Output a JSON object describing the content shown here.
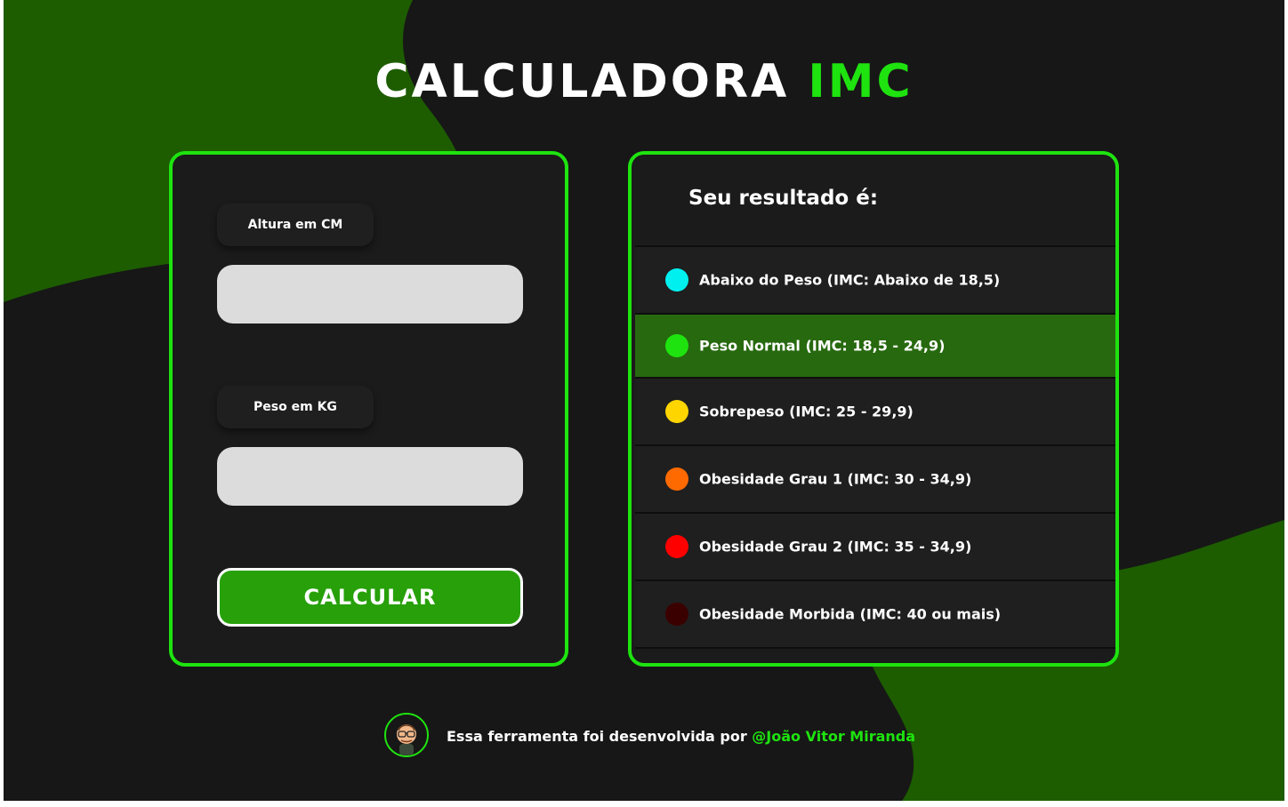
{
  "title": {
    "main": "CALCULADORA",
    "accent": "IMC"
  },
  "form": {
    "height_label": "Altura em CM",
    "height_value": "",
    "weight_label": "Peso em KG",
    "weight_value": "",
    "button_label": "CALCULAR"
  },
  "results": {
    "title": "Seu resultado é:",
    "items": [
      {
        "label": "Abaixo do Peso (IMC: Abaixo de 18,5)",
        "color": "#00f0f0",
        "active": false
      },
      {
        "label": "Peso Normal (IMC: 18,5 - 24,9)",
        "color": "#1ee30f",
        "active": true
      },
      {
        "label": "Sobrepeso (IMC: 25 - 29,9)",
        "color": "#ffd500",
        "active": false
      },
      {
        "label": "Obesidade Grau 1 (IMC: 30 - 34,9)",
        "color": "#ff6a00",
        "active": false
      },
      {
        "label": "Obesidade Grau 2 (IMC: 35 - 34,9)",
        "color": "#ff0000",
        "active": false
      },
      {
        "label": "Obesidade Morbida (IMC: 40 ou mais)",
        "color": "#3a0000",
        "active": false
      }
    ]
  },
  "footer": {
    "text": "Essa ferramenta foi desenvolvida por",
    "author_link": "@João Vitor Miranda"
  },
  "colors": {
    "accent": "#1ee30f",
    "background": "#171717",
    "blob": "#1d5d00",
    "button": "#27a00a",
    "active_row": "#27690f"
  }
}
